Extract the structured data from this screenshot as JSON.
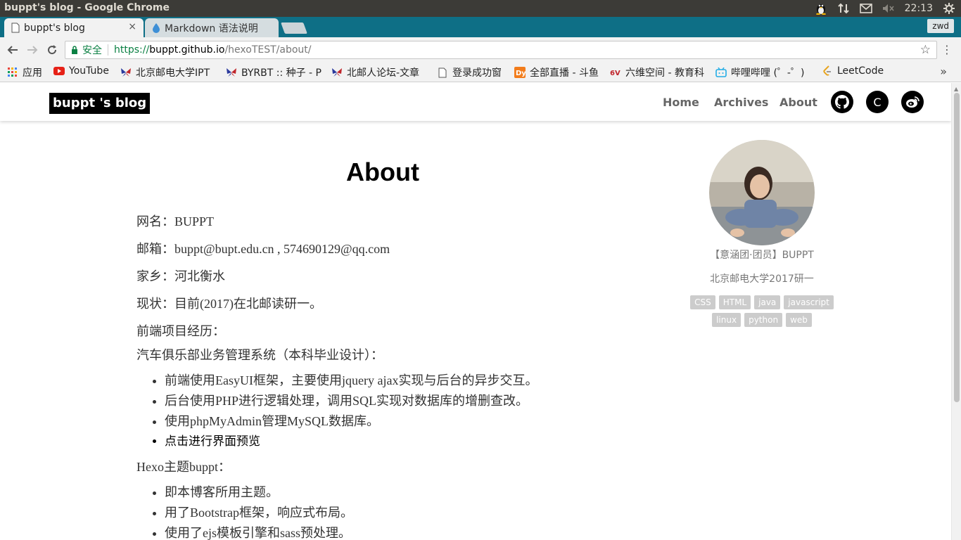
{
  "os": {
    "window_title": "buppt's blog - Google Chrome",
    "time": "22:13"
  },
  "tabs": [
    {
      "label": "buppt's blog",
      "close": "×"
    },
    {
      "label": "Markdown 语法说明"
    }
  ],
  "profile_button": "zwd",
  "address_bar": {
    "secure_label": "安全",
    "url_scheme": "https://",
    "url_host": "buppt.github.io",
    "url_path": "/hexoTEST/about/"
  },
  "bookmarks": [
    {
      "label": "应用",
      "icon": "apps-grid-icon"
    },
    {
      "label": "YouTube",
      "icon": "youtube-icon"
    },
    {
      "label": "北京邮电大学IPT",
      "icon": "butterfly-icon"
    },
    {
      "label": "BYRBT :: 种子 - P",
      "icon": "butterfly-icon"
    },
    {
      "label": "北邮人论坛-文章",
      "icon": "butterfly-icon"
    },
    {
      "label": "登录成功窗",
      "icon": "page-icon"
    },
    {
      "label": "全部直播 - 斗鱼",
      "icon": "douyu-icon"
    },
    {
      "label": "六维空间 - 教育科",
      "icon": "6v-icon"
    },
    {
      "label": "哔哩哔哩 (゜-゜)",
      "icon": "bilibili-icon"
    },
    {
      "label": "LeetCode",
      "icon": "leetcode-icon"
    }
  ],
  "blog": {
    "brand": "buppt 's blog",
    "nav": [
      "Home",
      "Archives",
      "About"
    ],
    "social": [
      {
        "icon": "github-icon",
        "glyph": ""
      },
      {
        "icon": "c-letter-icon",
        "glyph": "C"
      },
      {
        "icon": "weibo-icon",
        "glyph": ""
      }
    ]
  },
  "article": {
    "title": "About",
    "lines": [
      "网名：BUPPT",
      "邮箱：buppt@bupt.edu.cn , 574690129@qq.com",
      "家乡：河北衡水",
      "现状：目前(2017)在北邮读研一。",
      "前端项目经历：",
      "汽车俱乐部业务管理系统（本科毕业设计）："
    ],
    "list1": [
      "前端使用EasyUI框架，主要使用jquery ajax实现与后台的异步交互。",
      "后台使用PHP进行逻辑处理，调用SQL实现对数据库的增删查改。",
      "使用phpMyAdmin管理MySQL数据库。",
      "点击进行界面预览"
    ],
    "section2": "Hexo主题buppt：",
    "list2": [
      "即本博客所用主题。",
      "用了Bootstrap框架，响应式布局。",
      "使用了ejs模板引擎和sass预处理。"
    ]
  },
  "sidebar": {
    "name": "【意涵团·团员】BUPPT",
    "desc": "北京邮电大学2017研一",
    "tags": [
      "CSS",
      "HTML",
      "java",
      "javascript",
      "linux",
      "python",
      "web"
    ]
  }
}
